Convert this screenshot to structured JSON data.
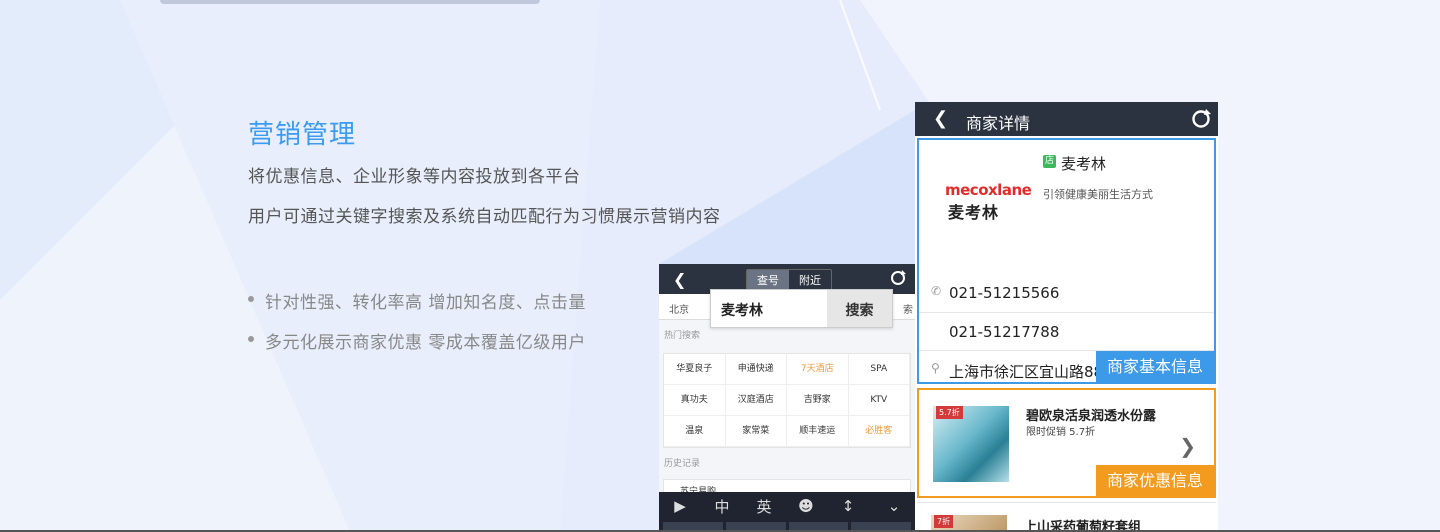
{
  "section": {
    "title": "营销管理",
    "lines": [
      "将优惠信息、企业形象等内容投放到各平台",
      "用户可通过关键字搜索及系统自动匹配行为习惯展示营销内容"
    ],
    "bullets": [
      "针对性强、转化率高  增加知名度、点击量",
      "多元化展示商家优惠  零成本覆盖亿级用户"
    ]
  },
  "search_phone": {
    "tabs": [
      "查号",
      "附近"
    ],
    "city": "北京",
    "filter_right": "索",
    "query": "麦考林",
    "search_button": "搜索",
    "hot_label": "热门搜索",
    "hot_items": [
      "华夏良子",
      "申通快递",
      "7天酒店",
      "SPA",
      "真功夫",
      "汉庭酒店",
      "吉野家",
      "KTV",
      "温泉",
      "家常菜",
      "顺丰速运",
      "必胜客"
    ],
    "history_label": "历史记录",
    "history_item": "苏宁易购",
    "keyboard": [
      "中",
      "英"
    ]
  },
  "detail_phone": {
    "title": "商家详情",
    "logo_en": "mecoxlane",
    "logo_zh": "麦考林",
    "badge": "店",
    "shop_name": "麦考林",
    "slogan": "引领健康美丽生活方式",
    "phone1": "021-51215566",
    "phone2": "021-51217788",
    "address": "上海市徐汇区宜山路88",
    "basic_tag": "商家基本信息",
    "promo_badge": "5.7折",
    "promo_name": "碧欧泉活泉润透水份露",
    "promo_sub": "限时促销 5.7折",
    "promo_tag": "商家优惠信息",
    "promo2_badge": "7折",
    "promo2_name": "上山采药葡萄籽套组"
  },
  "colors": {
    "accent_blue": "#3c9ae8",
    "accent_orange": "#f29b1e",
    "title_blue": "#3a9bf0",
    "topbar": "#2c3340"
  }
}
